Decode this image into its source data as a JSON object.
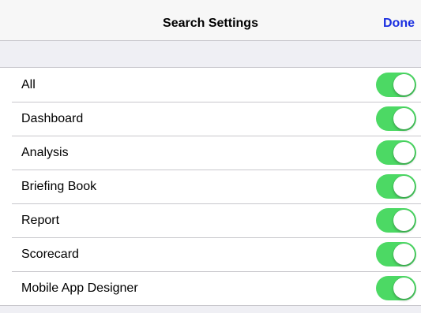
{
  "nav": {
    "title": "Search Settings",
    "done_label": "Done"
  },
  "settings": {
    "items": [
      {
        "label": "All",
        "enabled": true
      },
      {
        "label": "Dashboard",
        "enabled": true
      },
      {
        "label": "Analysis",
        "enabled": true
      },
      {
        "label": "Briefing Book",
        "enabled": true
      },
      {
        "label": "Report",
        "enabled": true
      },
      {
        "label": "Scorecard",
        "enabled": true
      },
      {
        "label": "Mobile App Designer",
        "enabled": true
      }
    ]
  },
  "colors": {
    "toggle_on": "#4cd964",
    "accent": "#1a2fe0",
    "background": "#efeff4"
  }
}
